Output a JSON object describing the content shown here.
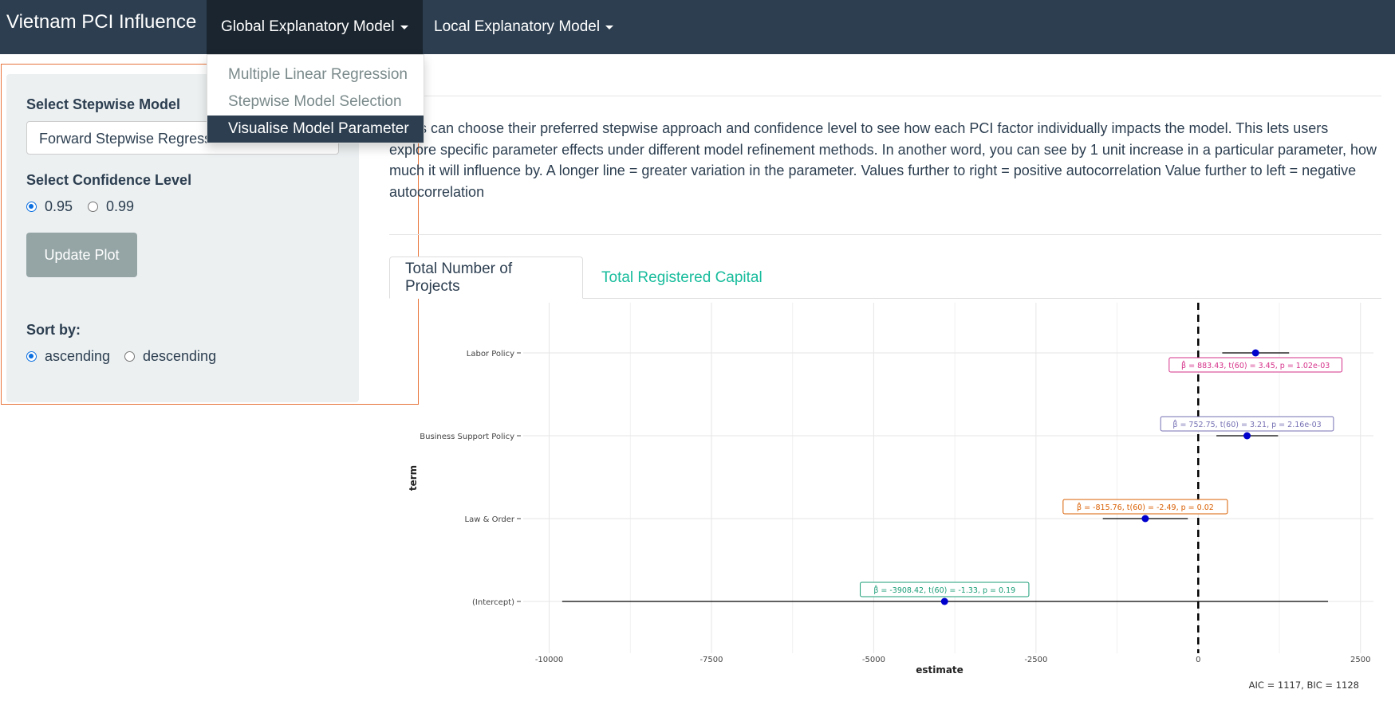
{
  "navbar": {
    "brand": "Vietnam PCI Influence",
    "menus": [
      {
        "label": "Global Explanatory Model"
      },
      {
        "label": "Local Explanatory Model"
      }
    ],
    "dropdown_items": [
      "Multiple Linear Regression",
      "Stepwise Model Selection",
      "Visualise Model Parameter"
    ]
  },
  "sidebar": {
    "stepwise_label": "Select Stepwise Model",
    "stepwise_value": "Forward Stepwise Regression",
    "confidence_label": "Select Confidence Level",
    "confidence_options": [
      "0.95",
      "0.99"
    ],
    "update_button": "Update Plot",
    "sort_label": "Sort by:",
    "sort_options": [
      "ascending",
      "descending"
    ]
  },
  "main": {
    "description": "Users can choose their preferred stepwise approach and confidence level to see how each PCI factor individually impacts the model. This lets users explore specific parameter effects under different model refinement methods. In another word, you can see by 1 unit increase in a particular parameter, how much it will influence by. A longer line = greater variation in the parameter. Values further to right = positive autocorrelation Value further to left = negative autocorrelation",
    "tabs": [
      "Total Number of Projects",
      "Total Registered Capital"
    ]
  },
  "colors": {
    "navbar": "#2c3e50",
    "accent": "#18bc9c",
    "outline": "#e8743b",
    "point": "#0000cd"
  },
  "chart_data": {
    "type": "scatter",
    "xlabel": "estimate",
    "ylabel": "term",
    "xlim": [
      -10400,
      2700
    ],
    "xticks": [
      -10000,
      -7500,
      -5000,
      -2500,
      0,
      2500
    ],
    "xtick_labels": [
      "-10000",
      "-7500",
      "-5000",
      "-2500",
      "0",
      "2500"
    ],
    "terms": [
      {
        "term": "Labor Policy",
        "estimate": 883.43,
        "ci": [
          370,
          1400
        ],
        "label_prefix": "β̂ = 883.43, ",
        "label_stats": "t(60) = 3.45, p = 1.02e-03",
        "color": "#d6328a",
        "label_pos": "below"
      },
      {
        "term": "Business Support Policy",
        "estimate": 752.75,
        "ci": [
          280,
          1230
        ],
        "label_prefix": "β̂ = 752.75, ",
        "label_stats": "t(60) = 3.21, p = 2.16e-03",
        "color": "#7570b3",
        "label_pos": "above"
      },
      {
        "term": "Law & Order",
        "estimate": -815.76,
        "ci": [
          -1470,
          -160
        ],
        "label_prefix": "β̂ = -815.76, ",
        "label_stats": "t(60) = -2.49, p = 0.02",
        "color": "#d95f02",
        "label_pos": "above"
      },
      {
        "term": "(Intercept)",
        "estimate": -3908.42,
        "ci": [
          -9800,
          2000
        ],
        "label_prefix": "β̂ = -3908.42, ",
        "label_stats": "t(60) = -1.33, p = 0.19",
        "color": "#1b9e77",
        "label_pos": "above"
      }
    ],
    "reference_line": 0,
    "caption": "AIC = 1117, BIC = 1128"
  }
}
